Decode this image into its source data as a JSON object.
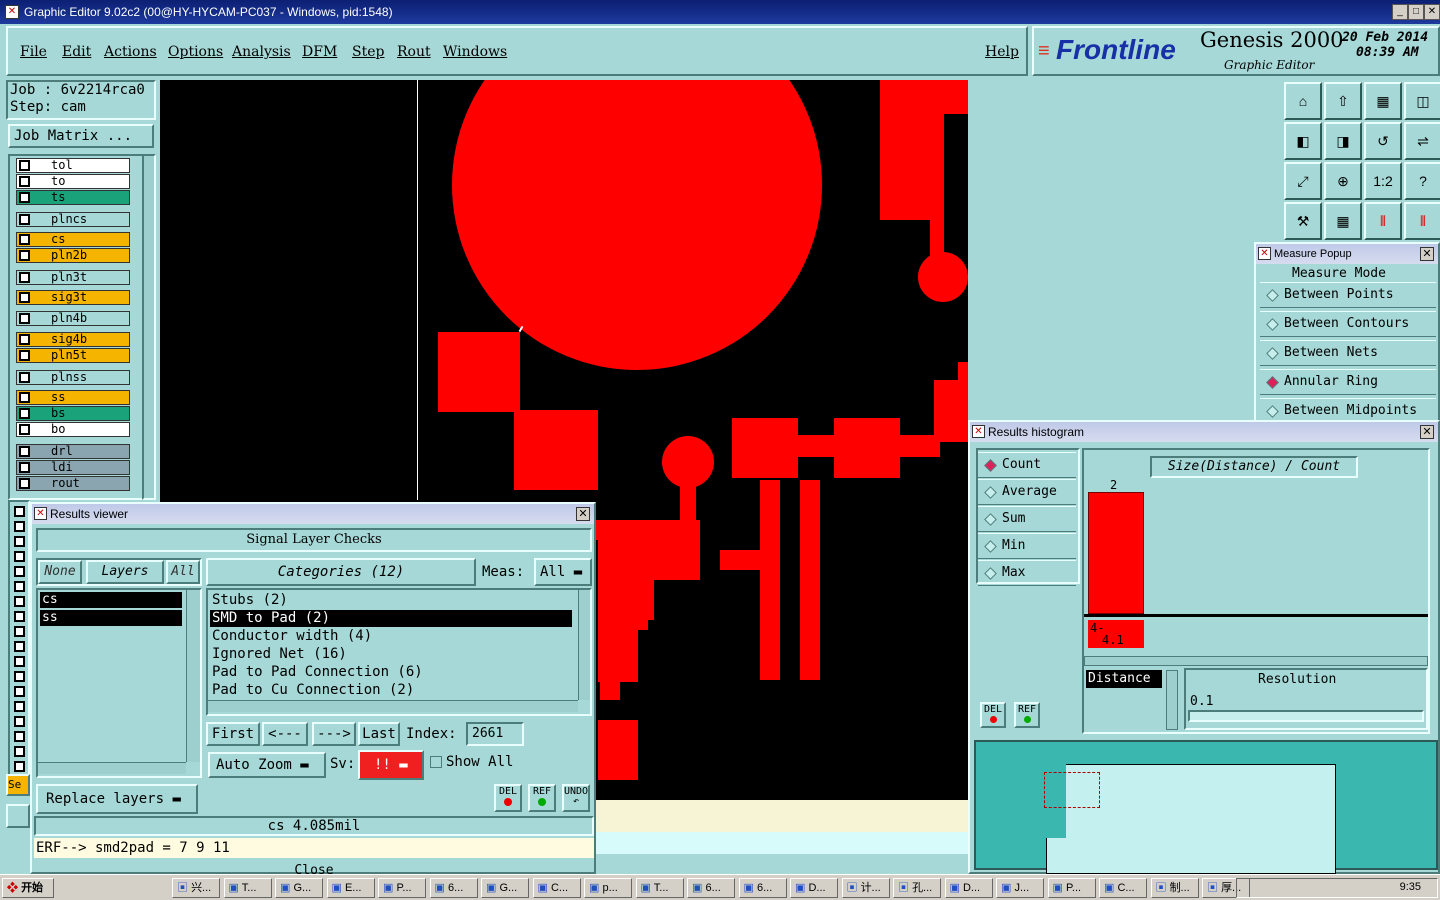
{
  "app": {
    "title": "Graphic Editor 9.02c2 (00@HY-HYCAM-PC037 - Windows, pid:1548)"
  },
  "menu": {
    "items": [
      "File",
      "Edit",
      "Actions",
      "Options",
      "Analysis",
      "DFM",
      "Step",
      "Rout",
      "Windows"
    ],
    "help": "Help"
  },
  "brand": {
    "logo": "Frontline",
    "product": "Genesis 2000",
    "subtitle": "Graphic Editor",
    "date": "20 Feb 2014",
    "time": "08:39 AM"
  },
  "job": {
    "job_line": "Job : 6v2214rca0",
    "step_line": "Step: cam",
    "matrix_button": "Job Matrix ..."
  },
  "layers": [
    {
      "name": "tol",
      "color": "#ffffff"
    },
    {
      "name": "to",
      "color": "#ffffff"
    },
    {
      "name": "ts",
      "color": "#1aa37a"
    },
    {
      "name": "plncs",
      "color": "#a5d8d6"
    },
    {
      "name": "cs",
      "color": "#f5b400"
    },
    {
      "name": "pln2b",
      "color": "#f5b400"
    },
    {
      "name": "pln3t",
      "color": "#a5d8d6"
    },
    {
      "name": "sig3t",
      "color": "#f5b400"
    },
    {
      "name": "pln4b",
      "color": "#a5d8d6"
    },
    {
      "name": "sig4b",
      "color": "#f5b400"
    },
    {
      "name": "pln5t",
      "color": "#f5b400"
    },
    {
      "name": "plnss",
      "color": "#a5d8d6"
    },
    {
      "name": "ss",
      "color": "#f5b400"
    },
    {
      "name": "bs",
      "color": "#1aa37a"
    },
    {
      "name": "bo",
      "color": "#ffffff"
    },
    {
      "name": "drl",
      "color": "#8aa5b0"
    },
    {
      "name": "ldi",
      "color": "#8aa5b0"
    },
    {
      "name": "rout",
      "color": "#8aa5b0"
    }
  ],
  "results_viewer": {
    "title": "Results viewer",
    "header": "Signal Layer Checks",
    "none_btn": "None",
    "layers_btn": "Layers",
    "all_btn": "All",
    "categories_btn": "Categories (12)",
    "meas_label": "Meas:",
    "meas_value": "All",
    "layer_list": [
      "cs",
      "ss"
    ],
    "categories": [
      "Stubs (2)",
      "SMD to Pad (2)",
      "Conductor width (4)",
      "Ignored Net (16)",
      "Pad to Pad Connection (6)",
      "Pad to Cu Connection (2)"
    ],
    "selected_category": "SMD to Pad (2)",
    "first": "First",
    "prev": "<---",
    "next": "--->",
    "last": "Last",
    "index_label": "Index:",
    "index_value": "2661",
    "auto_zoom": "Auto Zoom",
    "sv_label": "Sv:",
    "sv_value": "!!",
    "show_all": "Show All",
    "replace_layers": "Replace layers",
    "del": "DEL",
    "ref": "REF",
    "undo": "UNDO",
    "status": "cs 4.085mil",
    "erf": "ERF--> smd2pad = 7 9 11",
    "close": "Close"
  },
  "measure_popup": {
    "title": "Measure Popup",
    "mode": "Measure Mode",
    "items": [
      "Between Points",
      "Between Contours",
      "Between Nets",
      "Annular Ring",
      "Between Midpoints"
    ],
    "selected": "Annular Ring"
  },
  "histogram": {
    "title": "Results histogram",
    "options": [
      "Count",
      "Average",
      "Sum",
      "Min",
      "Max"
    ],
    "selected": "Count",
    "axis_title": "Size(Distance) / Count",
    "bar_count": "2",
    "bar_label_1": "4-",
    "bar_label_2": "4.1",
    "distance_label": "Distance",
    "resolution_label": "Resolution",
    "resolution_value": "0.1",
    "del": "DEL",
    "ref": "REF"
  },
  "toolbar": {
    "icons": [
      "home-icon",
      "zoom-in-icon",
      "window-icon",
      "panel-icon",
      "pan-left-icon",
      "pan-right-icon",
      "undo-zoom-icon",
      "snap-icon",
      "zoom-fit-icon",
      "center-icon",
      "ratio-icon",
      "help-icon",
      "tools-icon",
      "grid-icon",
      "measure-icon",
      "measure-alt-icon"
    ],
    "ratio_label": "1:2",
    "help_label": "?"
  },
  "taskbar": {
    "start": "开始",
    "clock": "9:35",
    "tasks": [
      "兴...",
      "T...",
      "G...",
      "E...",
      "P...",
      "6...",
      "G...",
      "C...",
      "p...",
      "T...",
      "6...",
      "6...",
      "D...",
      "计...",
      "孔...",
      "D...",
      "J...",
      "P...",
      "C...",
      "制...",
      "厚..."
    ]
  }
}
